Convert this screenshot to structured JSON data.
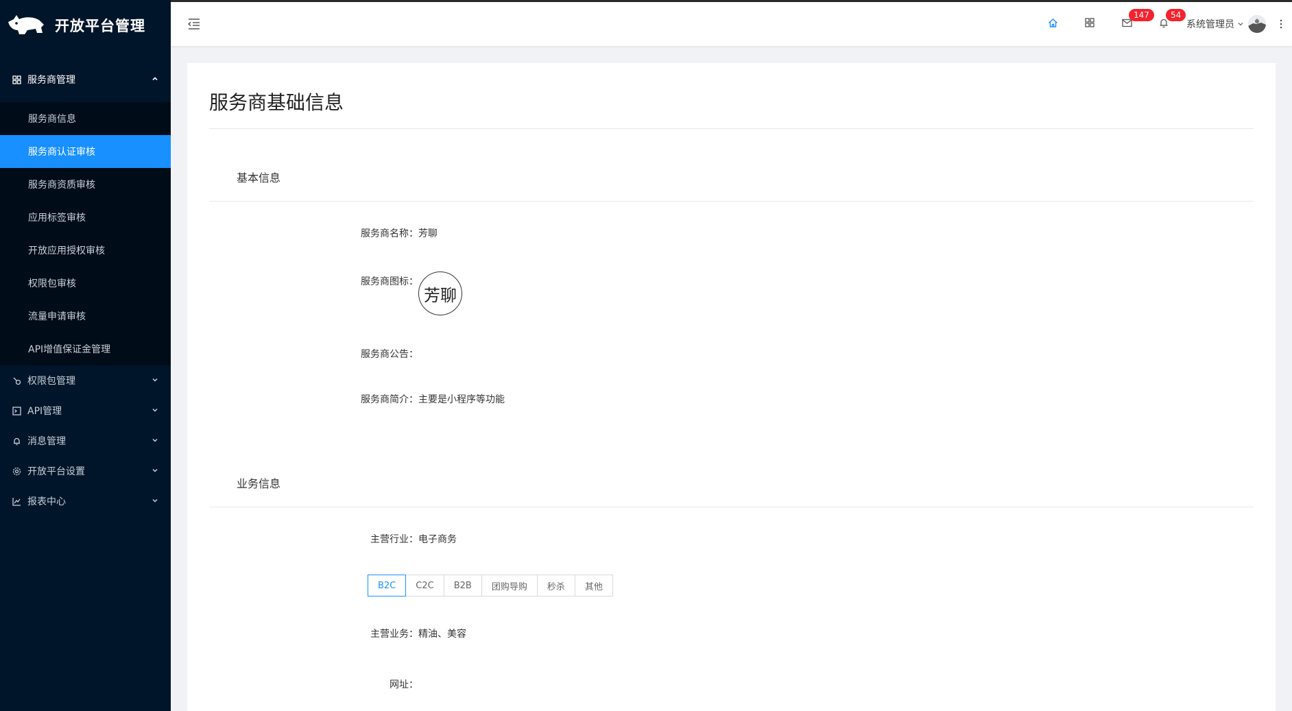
{
  "app": {
    "title": "开放平台管理"
  },
  "sidebar": {
    "group": {
      "label": "服务商管理",
      "items": [
        {
          "label": "服务商信息",
          "active": false
        },
        {
          "label": "服务商认证审核",
          "active": true
        },
        {
          "label": "服务商资质审核",
          "active": false
        },
        {
          "label": "应用标签审核",
          "active": false
        },
        {
          "label": "开放应用授权审核",
          "active": false
        },
        {
          "label": "权限包审核",
          "active": false
        },
        {
          "label": "流量申请审核",
          "active": false
        },
        {
          "label": "API增值保证金管理",
          "active": false
        }
      ]
    },
    "items": [
      {
        "label": "权限包管理",
        "icon": "link-icon"
      },
      {
        "label": "API管理",
        "icon": "terminal-icon"
      },
      {
        "label": "消息管理",
        "icon": "bell-icon"
      },
      {
        "label": "开放平台设置",
        "icon": "gear-icon"
      },
      {
        "label": "报表中心",
        "icon": "line-chart-icon"
      }
    ]
  },
  "header": {
    "mail_count": "147",
    "notification_count": "54",
    "user_name": "系统管理员"
  },
  "page": {
    "title": "服务商基础信息",
    "basic_section": {
      "title": "基本信息",
      "name_label": "服务商名称：",
      "name_value": "芳聊",
      "icon_label": "服务商图标：",
      "icon_text": "芳聊",
      "notice_label": "服务商公告：",
      "notice_value": "",
      "intro_label": "服务商简介：",
      "intro_value": "主要是小程序等功能"
    },
    "business_section": {
      "title": "业务信息",
      "industry_label": "主营行业：",
      "industry_value": "电子商务",
      "tabs": [
        "B2C",
        "C2C",
        "B2B",
        "团购导购",
        "秒杀",
        "其他"
      ],
      "active_tab": "B2C",
      "main_business_label": "主营业务：",
      "main_business_value": "精油、美容",
      "website_label": "网址：",
      "website_value": ""
    }
  },
  "colors": {
    "sidebar_bg": "#001529",
    "accent": "#1890ff",
    "badge": "#f5222d"
  }
}
